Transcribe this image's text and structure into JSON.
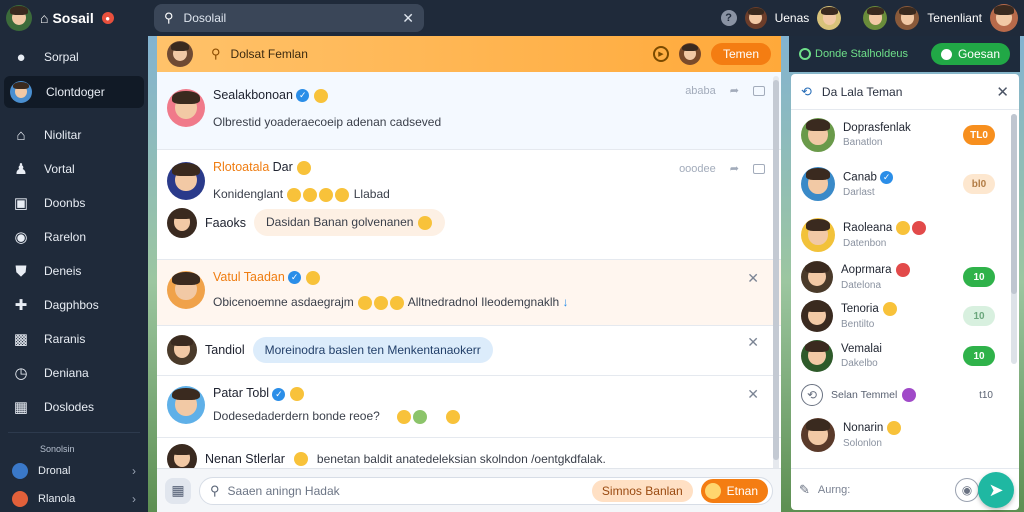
{
  "topbar": {
    "brand": "Sosail",
    "brand_badge": "●",
    "search_value": "Dosolail",
    "username_1": "Uenas",
    "username_2": "Tenenliant"
  },
  "sidebar": {
    "items": [
      {
        "label": "Sorpal",
        "icon": "people-icon"
      },
      {
        "label": "Clontdoger",
        "icon": "avatar-icon"
      },
      {
        "label": "Niolitar",
        "icon": "home-icon"
      },
      {
        "label": "Vortal",
        "icon": "person-icon"
      },
      {
        "label": "Doonbs",
        "icon": "profile-card-icon"
      },
      {
        "label": "Rarelon",
        "icon": "camera-icon"
      },
      {
        "label": "Deneis",
        "icon": "group-icon"
      },
      {
        "label": "Dagphbos",
        "icon": "add-user-icon"
      },
      {
        "label": "Raranis",
        "icon": "chat-icon"
      },
      {
        "label": "Deniana",
        "icon": "clock-icon"
      },
      {
        "label": "Doslodes",
        "icon": "grid-icon"
      }
    ],
    "section_heading": "Sonolsin",
    "sub_items": [
      {
        "label": "Dronal"
      },
      {
        "label": "Rlanola"
      }
    ]
  },
  "feed": {
    "header_title": "Dolsat Femlan",
    "header_button": "Temen",
    "posts": [
      {
        "name": "Sealakbonoan",
        "body": "Olbrestid yoaderaecoeip adenan cadseved",
        "meta": "ababa"
      },
      {
        "name": "Rlotoatala",
        "name_suffix": "Dar",
        "body": "Konidenglant",
        "body_suffix": "Llabad",
        "meta": "ooodee"
      },
      {
        "name": "Faaoks",
        "bubble": "Dasidan Banan golvenanen"
      },
      {
        "name": "Vatul Taadan",
        "body": "Obicenoemne asdaegrajm",
        "body_suffix": "Alltnedradnol Ileodemgnaklh"
      },
      {
        "name": "Tandiol",
        "bubble": "Moreinodra baslen ten Menkentanaokerr"
      },
      {
        "name": "Patar Tobl",
        "body": "Dodesedaderdern bonde reoe?"
      },
      {
        "name": "Nenan Stlerlar",
        "body": "benetan baldit anatedeleksian skolndon /oentgkdfalak."
      }
    ],
    "composer_placeholder": "Saaen aningn Hadak",
    "composer_tag": "Simnos Banlan",
    "composer_send": "Etnan"
  },
  "rpanel": {
    "top_link": "Donde Stalholdeus",
    "top_button": "Goesan",
    "title": "Da Lala Teman",
    "friends": [
      {
        "name": "Doprasfenlak",
        "sub": "Banatlon",
        "badge": "TL0"
      },
      {
        "name": "Canab",
        "sub": "Darlast",
        "badge": "bl0"
      },
      {
        "name": "Raoleana",
        "sub": "Datenbon",
        "badge": ""
      },
      {
        "name": "Aoprmara",
        "sub": "Datelona",
        "badge": "10"
      },
      {
        "name": "Tenoria",
        "sub": "Bentilto",
        "badge": "10"
      },
      {
        "name": "Vemalai",
        "sub": "Dakelbo",
        "badge": "10"
      },
      {
        "name": "Selan Temmel",
        "sub": "",
        "badge": "t10"
      },
      {
        "name": "Nonarin",
        "sub": "Solonlon",
        "badge": ""
      }
    ],
    "footer_placeholder": "Aurng:"
  },
  "colors": {
    "accent_orange": "#f47d12",
    "accent_green": "#21a846",
    "dark_bg": "#1f2a3a",
    "verify_blue": "#2b8ee8"
  }
}
